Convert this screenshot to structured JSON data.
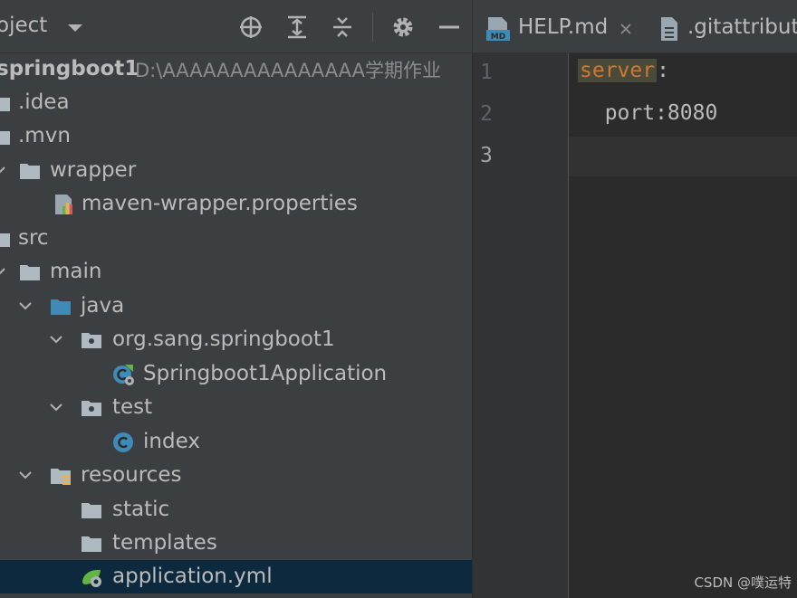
{
  "project_panel": {
    "title": "oject",
    "tree": [
      {
        "label": "springboot1",
        "path": "D:\\AAAAAAAAAAAAAAA学期作业",
        "icon": "module-icon"
      },
      {
        "label": ".idea",
        "icon": "folder-icon"
      },
      {
        "label": ".mvn",
        "icon": "folder-icon"
      },
      {
        "label": "wrapper",
        "icon": "folder-icon",
        "expanded": true
      },
      {
        "label": "maven-wrapper.properties",
        "icon": "properties-file-icon"
      },
      {
        "label": "src",
        "icon": "folder-icon"
      },
      {
        "label": "main",
        "icon": "folder-icon",
        "expanded": true
      },
      {
        "label": "java",
        "icon": "source-folder-icon",
        "expanded": true
      },
      {
        "label": "org.sang.springboot1",
        "icon": "package-icon",
        "expanded": true
      },
      {
        "label": "Springboot1Application",
        "icon": "spring-boot-class-icon"
      },
      {
        "label": "test",
        "icon": "package-icon",
        "expanded": true
      },
      {
        "label": "index",
        "icon": "class-icon"
      },
      {
        "label": "resources",
        "icon": "resources-folder-icon",
        "expanded": true
      },
      {
        "label": "static",
        "icon": "folder-icon"
      },
      {
        "label": "templates",
        "icon": "folder-icon"
      },
      {
        "label": "application.yml",
        "icon": "spring-yml-icon",
        "selected": true
      }
    ]
  },
  "editor": {
    "tabs": [
      {
        "label": "HELP.md",
        "icon": "markdown-icon",
        "closable": true
      },
      {
        "label": ".gitattribut",
        "icon": "text-file-icon"
      }
    ],
    "line_numbers": [
      "1",
      "2",
      "3"
    ],
    "code": {
      "line1_key": "server",
      "line1_colon": ":",
      "line2": "  port:8080"
    }
  },
  "watermark": "CSDN @噗运特",
  "colors": {
    "panel_bg": "#3c3f41",
    "editor_bg": "#2b2b2b",
    "selection_bg": "#0d293e",
    "keyword": "#cc7832",
    "folder": "#aeb9c0",
    "source_folder": "#3d8bb6"
  }
}
